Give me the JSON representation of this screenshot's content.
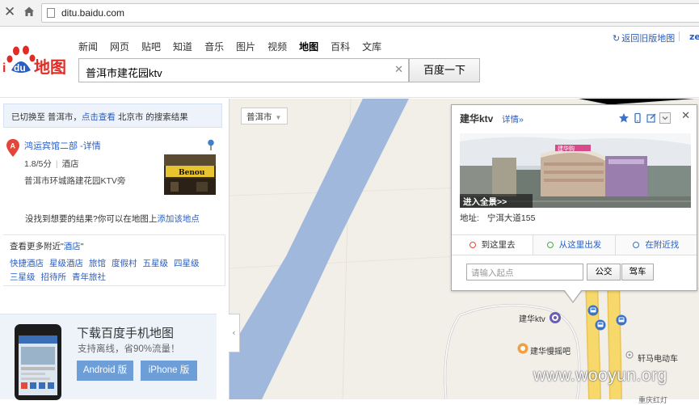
{
  "browser": {
    "url": "ditu.baidu.com"
  },
  "header": {
    "nav": [
      "新闻",
      "网页",
      "贴吧",
      "知道",
      "音乐",
      "图片",
      "视频",
      "地图",
      "百科",
      "文库"
    ],
    "active_nav": "地图",
    "search_value": "普洱市建花园ktv",
    "search_button": "百度一下",
    "old_version_link": "返回旧版地图",
    "logo_text": "Baidu地图",
    "right_edge_link": "ze"
  },
  "left_panel": {
    "notice_prefix": "已切换至 普洱市，",
    "notice_link": "点击查看",
    "notice_suffix": " 北京市 的搜索结果",
    "result": {
      "marker": "A",
      "title": "鸿运宾馆二部 -详情",
      "rating": "1.8/5分",
      "category": "酒店",
      "address": "普洱市环城路建花园KTV旁",
      "photo_sign": "Benou"
    },
    "not_found_text": "没找到想要的结果?你可以在地图上",
    "not_found_link": "添加该地点",
    "nearby_title_prefix": "查看更多附近\"",
    "nearby_title_link": "酒店",
    "nearby_title_suffix": "\"",
    "nearby_links": [
      "快捷酒店",
      "星级酒店",
      "旅馆",
      "度假村",
      "五星级",
      "四星级",
      "三星级",
      "招待所",
      "青年旅社"
    ],
    "promo": {
      "title": "下载百度手机地图",
      "subtitle": "支持离线，省90%流量！",
      "android": "Android 版",
      "iphone": "iPhone 版"
    }
  },
  "map": {
    "city_select": "普洱市",
    "collapse_arrow": "‹",
    "labels": {
      "ktv": "建华ktv",
      "bar": "建华慢摇吧",
      "shop": "轩马电动车",
      "bottom": "重庆红灯"
    },
    "info_window": {
      "title": "建华ktv",
      "detail_link": "详情»",
      "pano_label": "进入全景>>",
      "address_label": "地址:",
      "address_value": "宁洱大道155",
      "tabs": [
        "到这里去",
        "从这里出发",
        "在附近找"
      ],
      "input_placeholder": "请输入起点",
      "bus_button": "公交",
      "car_button": "驾车",
      "building_sign": "建华购"
    }
  },
  "watermark": "www.wooyun.org",
  "colors": {
    "link_blue": "#2a5ec0",
    "river_blue": "#9fb8dc",
    "road_yellow": "#f7d86a",
    "map_bg": "#f2efe9",
    "marker_red": "#e2453a"
  }
}
